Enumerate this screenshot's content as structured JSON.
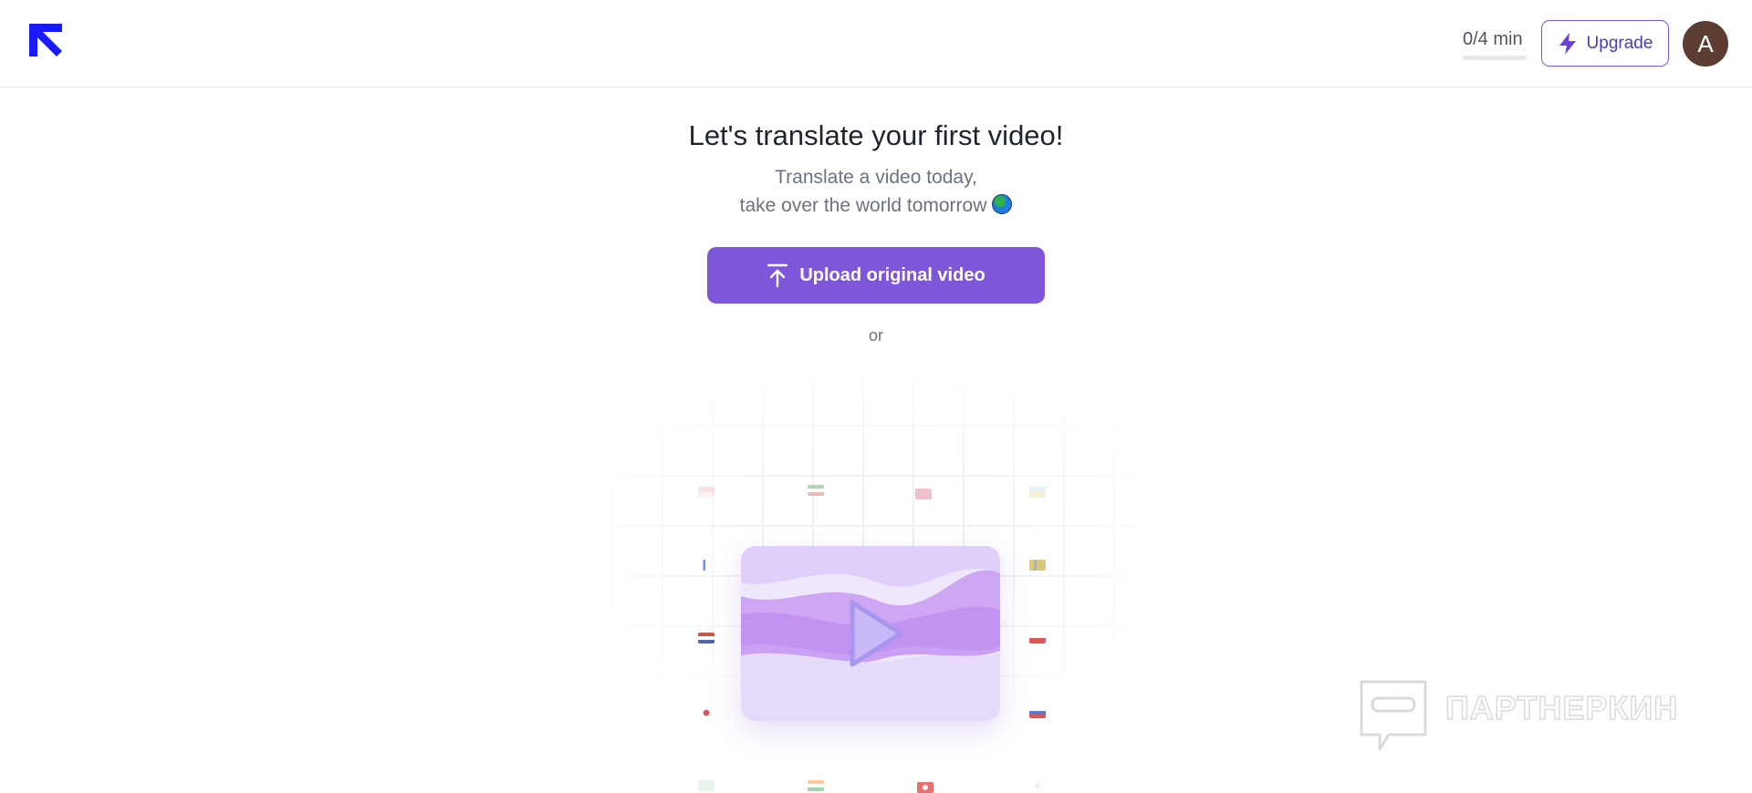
{
  "header": {
    "logo_icon": "arrow-up-left-logo-icon",
    "usage_text": "0/4 min",
    "usage_fraction": 0,
    "upgrade_label": "Upgrade",
    "upgrade_icon": "lightning-bolt-icon",
    "avatar_initial": "A",
    "avatar_color": "#5b3d32"
  },
  "main": {
    "title": "Let's translate your first video!",
    "subtitle_line1": "Translate a video today,",
    "subtitle_line2": "take over the world tomorrow",
    "subtitle_icon": "globe-emoji-icon",
    "upload_label": "Upload original video",
    "upload_icon": "upload-arrow-icon",
    "or_text": "or"
  },
  "illustration": {
    "flags": [
      "flag-icon",
      "flag-icon",
      "flag-icon",
      "flag-icon",
      "flag-icon",
      "flag-icon",
      "flag-icon",
      "flag-icon",
      "flag-icon",
      "flag-icon",
      "flag-icon",
      "flag-icon",
      "flag-icon",
      "flag-icon"
    ],
    "video_icon": "play-icon"
  },
  "watermark": {
    "text": "ПАРТНЕРКИН"
  },
  "colors": {
    "accent": "#7e57d9",
    "logo": "#1a1aff",
    "text_muted": "#6b7280"
  }
}
